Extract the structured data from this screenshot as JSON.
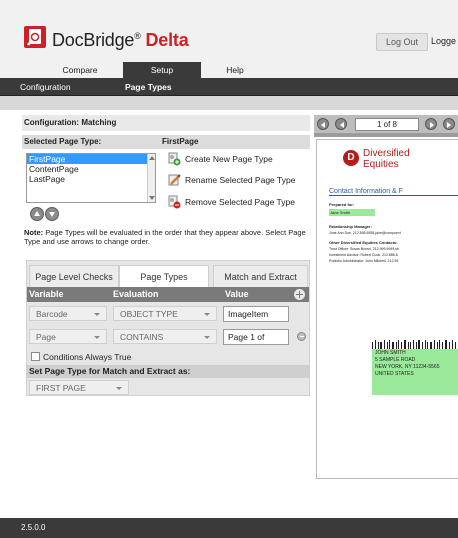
{
  "app": {
    "name": "DocBridge",
    "reg": "®",
    "product": "Delta",
    "logout_label": "Log Out",
    "logged_text": "Logge",
    "brand_color": "#cc2127"
  },
  "topnav": {
    "items": [
      {
        "label": "Compare"
      },
      {
        "label": "Setup"
      },
      {
        "label": "Help"
      }
    ],
    "active": "Setup"
  },
  "subnav": {
    "items": [
      {
        "label": "Configuration"
      },
      {
        "label": "Page Types"
      }
    ],
    "active": "Page Types"
  },
  "config": {
    "title": "Configuration: Matching",
    "selected_label": "Selected Page Type:",
    "selected_value": "FirstPage",
    "page_types": [
      {
        "label": "FirstPage",
        "selected": true
      },
      {
        "label": "ContentPage",
        "selected": false
      },
      {
        "label": "LastPage",
        "selected": false
      }
    ],
    "actions": {
      "create": "Create New Page Type",
      "rename": "Rename Selected Page Type",
      "remove": "Remove Selected Page Type"
    },
    "note_bold": "Note:",
    "note_text": " Page Types will be evaluated in the order that they appear above. Select Page Type and use arrows to change order."
  },
  "tabs": [
    {
      "label": "Page Level Checks",
      "active": false
    },
    {
      "label": "Page Types",
      "active": true
    },
    {
      "label": "Match and Extract",
      "active": false
    }
  ],
  "grid": {
    "headers": {
      "variable": "Variable",
      "evaluation": "Evaluation",
      "value": "Value"
    },
    "rows": [
      {
        "variable": "Barcode",
        "evaluation": "OBJECT TYPE",
        "value": "ImageItem"
      },
      {
        "variable": "Page",
        "evaluation": "CONTAINS",
        "value": "Page 1 of"
      }
    ],
    "conditions_label": "Conditions Always True",
    "conditions_checked": false,
    "set_label": "Set Page Type for Match and Extract as:",
    "set_value": "FIRST PAGE"
  },
  "viewer": {
    "page_indicator": "1 of 8",
    "doc": {
      "logo_letter": "D",
      "company_line1": "Diversified",
      "company_line2": "Equities",
      "section_title": "Contact Information & F",
      "prepared_label": "Prepared for:",
      "prepared_value": "Jane Smith",
      "rm_label": "Relationship Manager:",
      "rm_value": "June Ann Doe, 212.555.5555,jdoe@compuext",
      "contacts_label": "Other Diversified Equities Contacts:",
      "contacts": [
        "Trust Officer: Susan Brown, 212.999.9999,sb",
        "Investment Advisor: Robert Cook, 212.888.8",
        "Portfolio Administrator: John Mitchell, 212.99"
      ],
      "address": [
        "JOHN SMITH",
        "5 SAMPLE ROAD",
        "NEW YORK, NY 11234-5565",
        "UNITED STATES"
      ],
      "highlight_color": "#9ae89a"
    }
  },
  "footer": {
    "version": "2.5.0.0"
  }
}
